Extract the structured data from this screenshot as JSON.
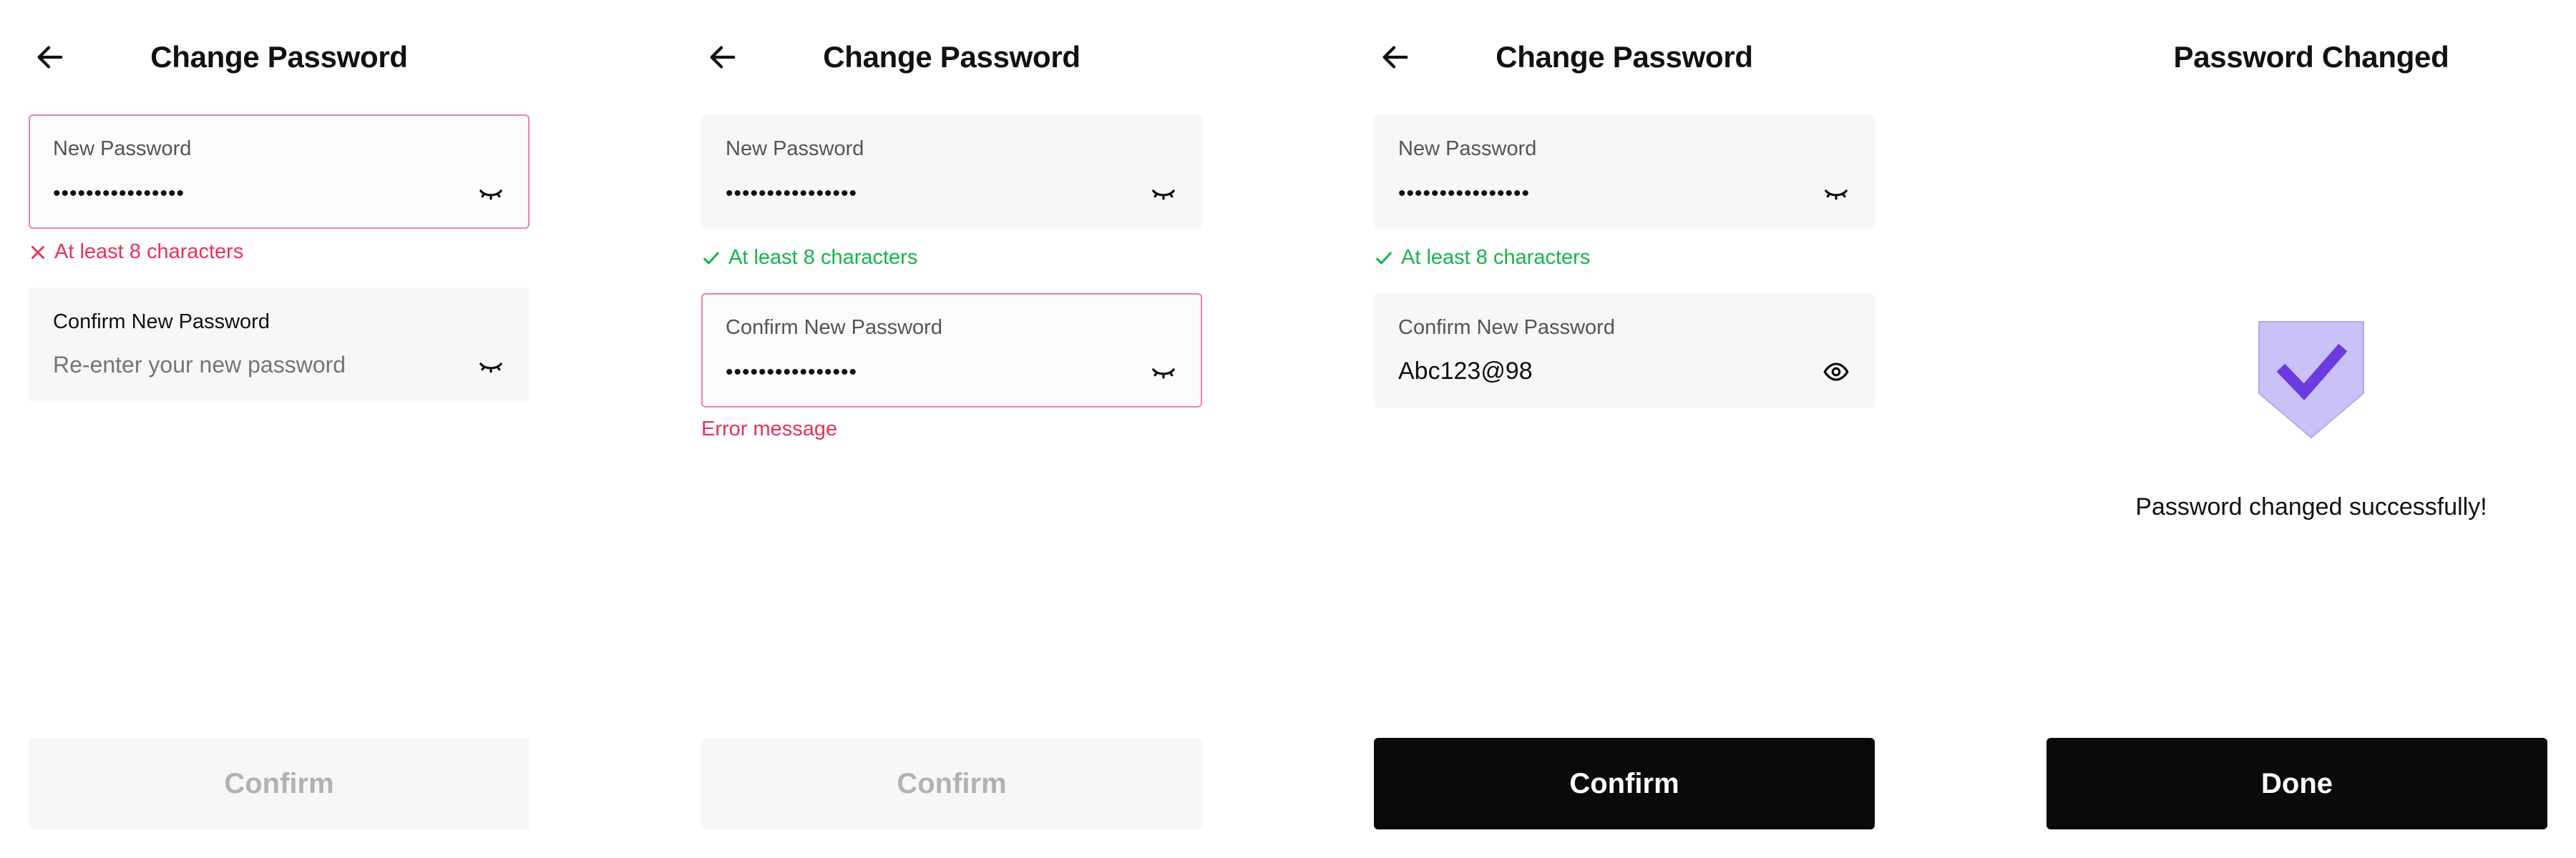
{
  "colors": {
    "error": "#e8315a",
    "error_border": "#f0839a",
    "success": "#14b54a",
    "primary_button": "#0a0a0a",
    "disabled_text": "#b2b2b2",
    "shield_fill": "#c9c1f7",
    "shield_check": "#6c3ae0"
  },
  "screens": [
    {
      "title": "Change Password",
      "new_password": {
        "label": "New Password",
        "value": "••••••••••••••••",
        "eye_icon": "eye-closed-icon"
      },
      "hint": {
        "icon": "x-icon",
        "text": "At least 8 characters"
      },
      "confirm_password": {
        "label": "Confirm New Password",
        "placeholder": "Re-enter your new password",
        "eye_icon": "eye-closed-icon"
      },
      "button": {
        "label": "Confirm",
        "state": "disabled"
      }
    },
    {
      "title": "Change Password",
      "new_password": {
        "label": "New Password",
        "value": "••••••••••••••••",
        "eye_icon": "eye-closed-icon"
      },
      "hint": {
        "icon": "check-icon",
        "text": "At least 8 characters"
      },
      "confirm_password": {
        "label": "Confirm New Password",
        "value": "••••••••••••••••",
        "eye_icon": "eye-closed-icon"
      },
      "error_message": "Error message",
      "button": {
        "label": "Confirm",
        "state": "disabled"
      }
    },
    {
      "title": "Change Password",
      "new_password": {
        "label": "New Password",
        "value": "••••••••••••••••",
        "eye_icon": "eye-closed-icon"
      },
      "hint": {
        "icon": "check-icon",
        "text": "At least 8 characters"
      },
      "confirm_password": {
        "label": "Confirm New Password",
        "value": "Abc123@98",
        "eye_icon": "eye-open-icon"
      },
      "button": {
        "label": "Confirm",
        "state": "enabled"
      }
    },
    {
      "title": "Password Changed",
      "success_message": "Password changed successfully!",
      "button": {
        "label": "Done",
        "state": "enabled"
      }
    }
  ]
}
